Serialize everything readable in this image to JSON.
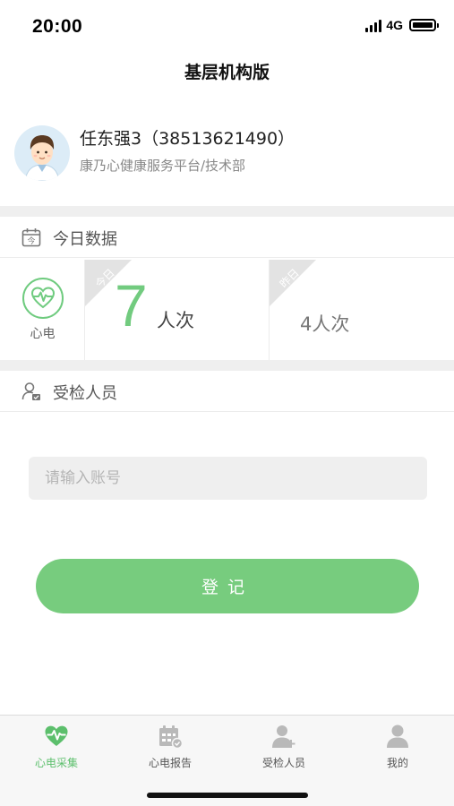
{
  "status_bar": {
    "time": "20:00",
    "network": "4G"
  },
  "nav": {
    "title": "基层机构版"
  },
  "profile": {
    "name": "任东强3（38513621490）",
    "org": "康乃心健康服务平台/技术部"
  },
  "today_section": {
    "title": "今日数据",
    "icon": "calendar-today-icon"
  },
  "stats": {
    "ecg_label": "心电",
    "today": {
      "ribbon": "今日",
      "count": "7",
      "unit": "人次"
    },
    "yesterday": {
      "ribbon": "昨日",
      "text": "4人次"
    }
  },
  "examinee_section": {
    "title": "受检人员",
    "icon": "person-check-icon"
  },
  "form": {
    "account_placeholder": "请输入账号",
    "register_label": "登记"
  },
  "tabs": [
    {
      "label": "心电采集",
      "icon": "heart-pulse-icon",
      "active": true
    },
    {
      "label": "心电报告",
      "icon": "report-calendar-icon",
      "active": false
    },
    {
      "label": "受检人员",
      "icon": "person-add-icon",
      "active": false
    },
    {
      "label": "我的",
      "icon": "person-icon",
      "active": false
    }
  ],
  "colors": {
    "accent": "#77cc7e",
    "background": "#ffffff",
    "band": "#efefef"
  }
}
